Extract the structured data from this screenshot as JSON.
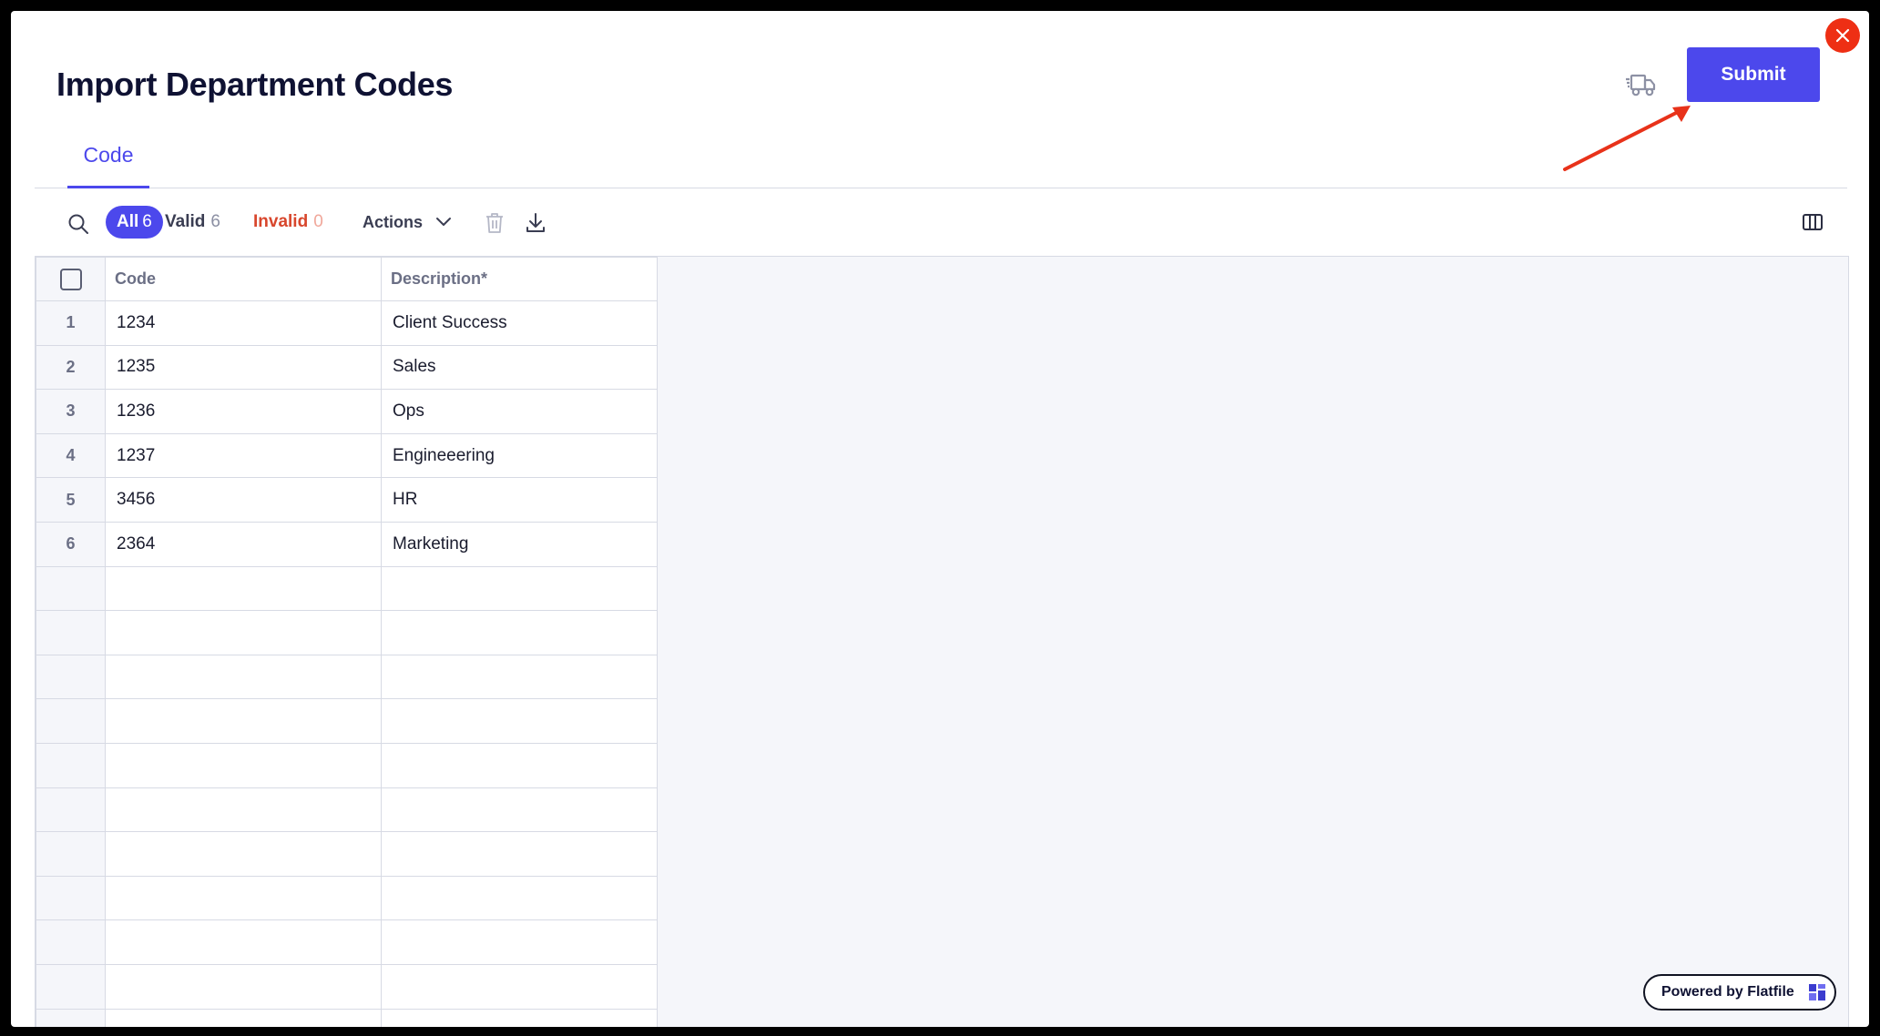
{
  "header": {
    "title": "Import Department Codes",
    "submit_label": "Submit"
  },
  "tabs": [
    {
      "label": "Code",
      "active": true
    }
  ],
  "toolbar": {
    "filter_all_label": "All",
    "filter_all_count": "6",
    "filter_valid_label": "Valid",
    "filter_valid_count": "6",
    "filter_invalid_label": "Invalid",
    "filter_invalid_count": "0",
    "actions_label": "Actions"
  },
  "table": {
    "columns": [
      "Code",
      "Description*"
    ],
    "rows": [
      {
        "index": "1",
        "code": "1234",
        "description": "Client Success"
      },
      {
        "index": "2",
        "code": "1235",
        "description": "Sales"
      },
      {
        "index": "3",
        "code": "1236",
        "description": "Ops"
      },
      {
        "index": "4",
        "code": "1237",
        "description": "Engineeering"
      },
      {
        "index": "5",
        "code": "3456",
        "description": "HR"
      },
      {
        "index": "6",
        "code": "2364",
        "description": "Marketing"
      }
    ]
  },
  "footer": {
    "powered_by": "Powered by Flatfile"
  },
  "colors": {
    "accent": "#4c48ec",
    "close": "#ee2f14",
    "invalid": "#d8462c",
    "annotation_arrow": "#e8321a"
  },
  "icons": [
    "truck-icon",
    "close-icon",
    "search-icon",
    "chevron-down-icon",
    "trash-icon",
    "download-icon",
    "columns-icon",
    "flatfile-logo-icon"
  ]
}
